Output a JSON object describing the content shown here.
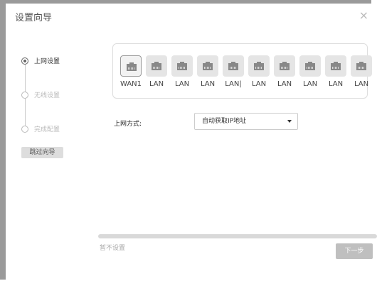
{
  "window": {
    "title": "设置向导",
    "close_icon": "×"
  },
  "steps": [
    {
      "label": "上网设置",
      "active": true
    },
    {
      "label": "无线设置",
      "active": false
    },
    {
      "label": "完成配置",
      "active": false
    }
  ],
  "sidebar": {
    "skip_label": "跳过向导"
  },
  "ports": [
    {
      "label": "WAN1"
    },
    {
      "label": "LAN"
    },
    {
      "label": "LAN"
    },
    {
      "label": "LAN"
    },
    {
      "label": "LAN|"
    },
    {
      "label": "LAN"
    },
    {
      "label": "LAN"
    },
    {
      "label": "LAN"
    },
    {
      "label": "LAN"
    },
    {
      "label": "LAN"
    }
  ],
  "connection": {
    "label": "上网方式:",
    "selected": "自动获取IP地址"
  },
  "footer": {
    "progress_fraction": 0.0,
    "not_set": "暂不设置",
    "next_label": "下一步"
  }
}
